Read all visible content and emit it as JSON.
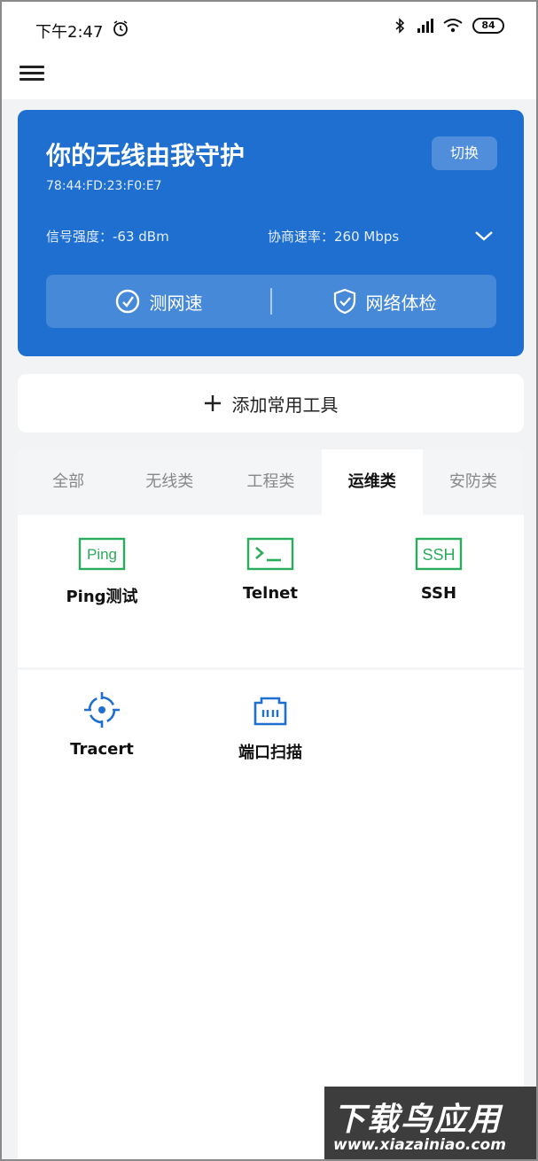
{
  "status_bar": {
    "time": "下午2:47",
    "battery": "84",
    "icons": [
      "alarm-icon",
      "bluetooth-icon",
      "signal-icon",
      "wifi-icon",
      "battery-icon"
    ]
  },
  "wifi_card": {
    "title": "你的无线由我守护",
    "mac": "78:44:FD:23:F0:E7",
    "switch_label": "切换",
    "signal": "信号强度：-63 dBm",
    "rate": "协商速率：260 Mbps",
    "actions": [
      {
        "label": "测网速",
        "icon": "speed-test-icon"
      },
      {
        "label": "网络体检",
        "icon": "shield-check-icon"
      }
    ],
    "color": "#1f6fd1"
  },
  "add_tool": {
    "label": "添加常用工具",
    "icon": "plus-icon"
  },
  "tabs": [
    {
      "label": "全部",
      "active": false
    },
    {
      "label": "无线类",
      "active": false
    },
    {
      "label": "工程类",
      "active": false
    },
    {
      "label": "运维类",
      "active": true
    },
    {
      "label": "安防类",
      "active": false
    }
  ],
  "tools": [
    {
      "label": "Ping测试",
      "icon_text": "Ping",
      "icon": "ping-icon",
      "color": "#2bab5c"
    },
    {
      "label": "Telnet",
      "icon_text": ">_",
      "icon": "terminal-icon",
      "color": "#2bab5c"
    },
    {
      "label": "SSH",
      "icon_text": "SSH",
      "icon": "ssh-icon",
      "color": "#2bab5c"
    },
    {
      "label": "Tracert",
      "icon": "crosshair-icon",
      "color": "#1f6fd1"
    },
    {
      "label": "端口扫描",
      "icon": "ethernet-port-icon",
      "color": "#1f6fd1"
    }
  ],
  "watermark": {
    "title": "下载鸟应用",
    "url": "www.xiazainiao.com"
  }
}
